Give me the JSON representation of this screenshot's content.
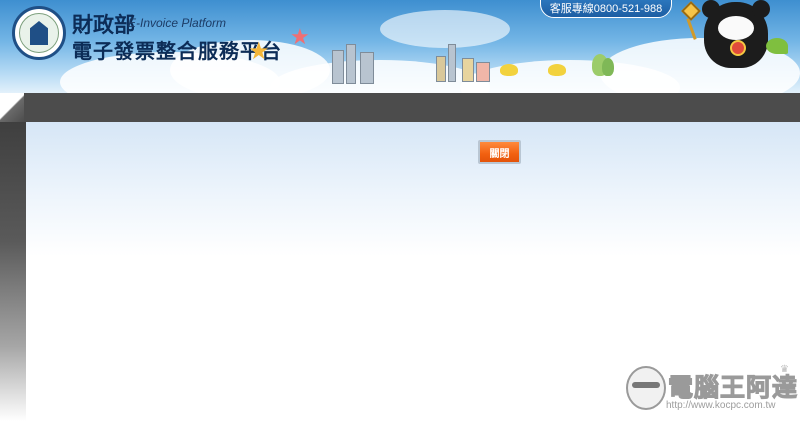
{
  "header": {
    "org_name": "財政部",
    "platform_en": "E-Invoice Platform",
    "platform_zh": "電子發票整合服務平台",
    "hotline": "客服專線0800-521-988"
  },
  "main": {
    "close_button_label": "關閉"
  },
  "watermark": {
    "title": "電腦王阿達",
    "url": "http://www.kocpc.com.tw"
  },
  "colors": {
    "header_blue": "#3e8fd0",
    "frame_gray": "#4c4c4c",
    "close_button_orange": "#f26010",
    "title_navy": "#0c2c57"
  },
  "icons": {
    "emblem": "ministry-emblem-icon",
    "mascot": "bear-mascot-icon",
    "watermark_face": "watermark-face-icon"
  }
}
